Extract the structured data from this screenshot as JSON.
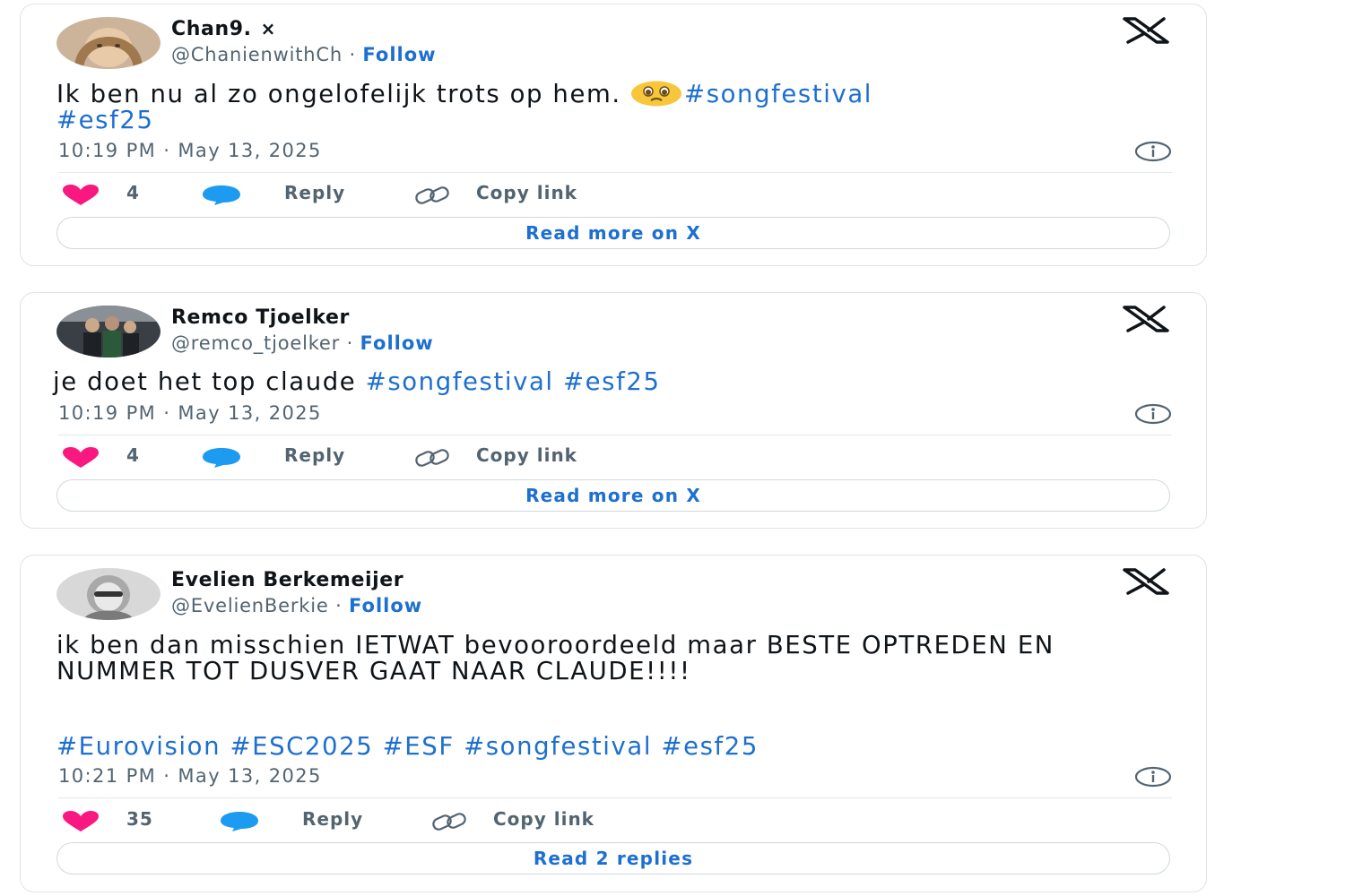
{
  "tweets": [
    {
      "name": "Chan9.",
      "name_mark": "×",
      "handle": "@ChanienwithCh",
      "sep": "·",
      "follow": "Follow",
      "text_parts": [
        "Ik ben nu al zo ongelofelijk trots op hem. ",
        "#songfestival",
        "#esf25"
      ],
      "emoji": "pleading-face-emoji",
      "time": "10:19 PM · May 13, 2025",
      "likes": "4",
      "reply": "Reply",
      "copy_link": "Copy link",
      "cta": "Read more on X"
    },
    {
      "name": "Remco Tjoelker",
      "handle": "@remco_tjoelker",
      "sep": "·",
      "follow": "Follow",
      "text_parts": [
        "je doet het top claude ",
        "#songfestival",
        " ",
        "#esf25"
      ],
      "time": "10:19 PM · May 13, 2025",
      "likes": "4",
      "reply": "Reply",
      "copy_link": "Copy link",
      "cta": "Read more on X"
    },
    {
      "name": "Evelien Berkemeijer",
      "handle": "@EvelienBerkie",
      "sep": "·",
      "follow": "Follow",
      "text_line1": "ik ben dan misschien IETWAT bevooroordeeld maar BESTE OPTREDEN EN NUMMER TOT DUSVER GAAT NAAR CLAUDE!!!!",
      "hashtags": "#Eurovision #ESC2025 #ESF #songfestival #esf25",
      "time": "10:21 PM · May 13, 2025",
      "likes": "35",
      "reply": "Reply",
      "copy_link": "Copy link",
      "cta": "Read 2 replies"
    }
  ],
  "colors": {
    "link": "#1d6fd0",
    "heart": "#f91880",
    "reply": "#1d9bf0",
    "muted": "#536471"
  }
}
